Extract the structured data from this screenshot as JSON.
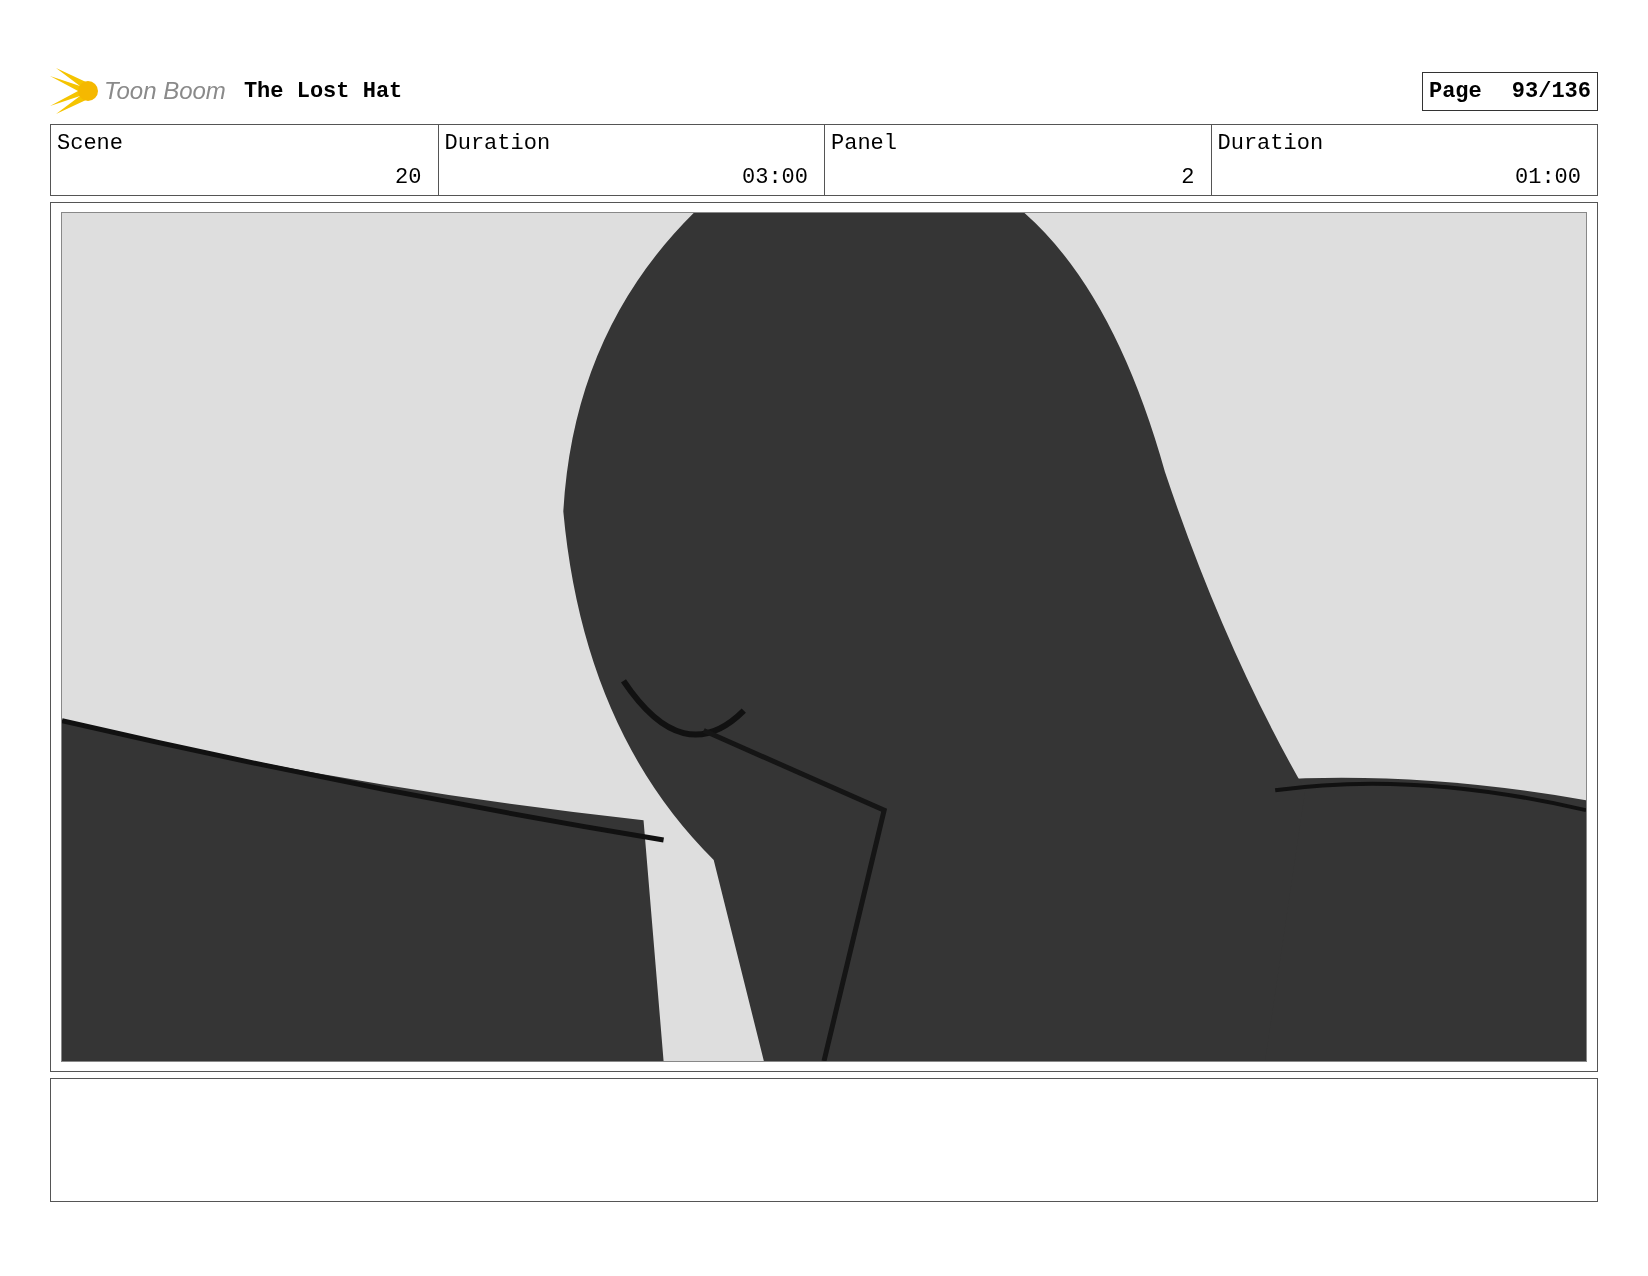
{
  "header": {
    "logo": "Toon Boom",
    "title": "The Lost Hat",
    "page_label": "Page",
    "page_number": "93/136"
  },
  "fields": [
    {
      "label": "Scene",
      "value": "20"
    },
    {
      "label": "Duration",
      "value": "03:00"
    },
    {
      "label": "Panel",
      "value": "2"
    },
    {
      "label": "Duration",
      "value": "01:00"
    }
  ],
  "panel": {
    "kind": "drawing"
  }
}
